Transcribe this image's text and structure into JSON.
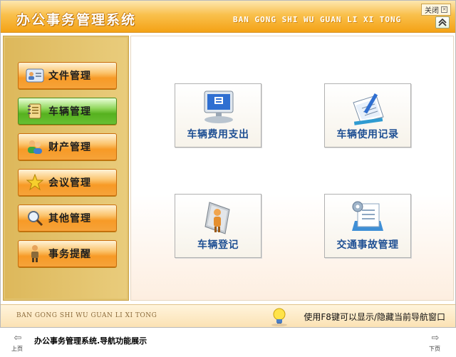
{
  "window": {
    "title": "办公事务管理系统",
    "pinyin_title": "BAN GONG SHI WU GUAN LI XI TONG",
    "close_label": "关闭",
    "close_glyph": "×",
    "collapse_glyph": "︽"
  },
  "sidebar": {
    "items": [
      {
        "label": "文件管理",
        "icon": "contact-card-icon",
        "active": false
      },
      {
        "label": "车辆管理",
        "icon": "notepad-icon",
        "active": true
      },
      {
        "label": "财产管理",
        "icon": "people-icon",
        "active": false
      },
      {
        "label": "会议管理",
        "icon": "star-icon",
        "active": false
      },
      {
        "label": "其他管理",
        "icon": "magnifier-icon",
        "active": false
      },
      {
        "label": "事务提醒",
        "icon": "person-icon",
        "active": false
      }
    ]
  },
  "main": {
    "tiles": [
      {
        "label": "车辆费用支出",
        "icon": "computer-monitor-icon"
      },
      {
        "label": "车辆使用记录",
        "icon": "notepad-pen-icon"
      },
      {
        "label": "车辆登记",
        "icon": "person-document-icon"
      },
      {
        "label": "交通事故管理",
        "icon": "document-gear-icon"
      }
    ]
  },
  "statusbar": {
    "pinyin": "BAN GONG SHI WU GUAN LI XI TONG",
    "hint": "使用F8键可以显示/隐藏当前导航窗口"
  },
  "navbar": {
    "prev_label": "上页",
    "next_label": "下页",
    "caption": "办公事务管理系统.导航功能展示",
    "prev_glyph": "⇦",
    "next_glyph": "⇨"
  },
  "colors": {
    "title_orange": "#f4a215",
    "active_green": "#56b11f",
    "tile_text": "#1e4f93"
  }
}
